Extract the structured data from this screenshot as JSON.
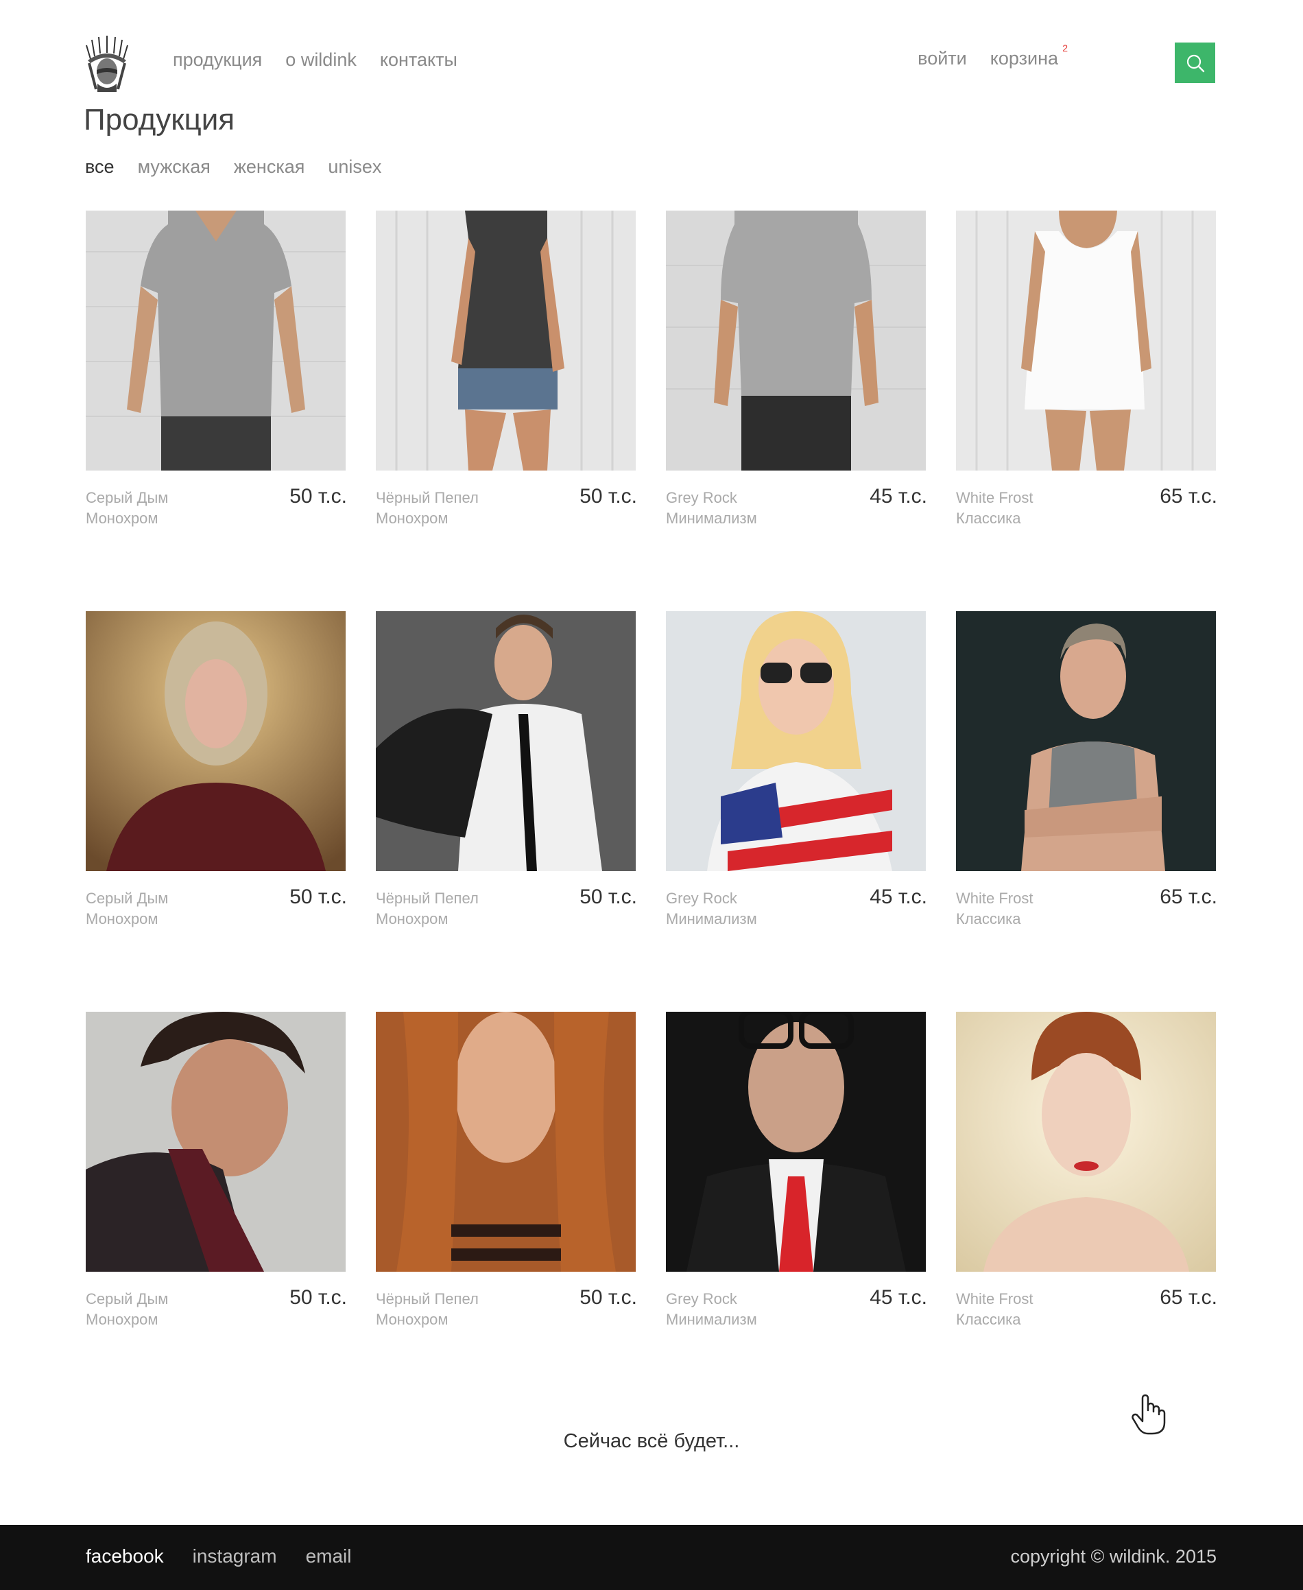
{
  "header": {
    "nav": [
      "продукция",
      "о wildink",
      "контакты"
    ],
    "login_label": "войти",
    "cart_label": "корзина",
    "cart_count": "2",
    "search_icon": "search-icon",
    "accent_color": "#3db66a"
  },
  "page": {
    "title": "Продукция",
    "filters": [
      "все",
      "мужская",
      "женская",
      "unisex"
    ],
    "active_filter": "все"
  },
  "products": [
    {
      "name1": "Серый Дым",
      "name2": "Монохром",
      "price": "50 т.с."
    },
    {
      "name1": "Чёрный Пепел",
      "name2": "Монохром",
      "price": "50 т.с."
    },
    {
      "name1": "Grey Rock",
      "name2": "Минимализм",
      "price": "45 т.с."
    },
    {
      "name1": "White Frost",
      "name2": "Классика",
      "price": "65 т.с."
    },
    {
      "name1": "Серый Дым",
      "name2": "Монохром",
      "price": "50 т.с."
    },
    {
      "name1": "Чёрный Пепел",
      "name2": "Монохром",
      "price": "50 т.с."
    },
    {
      "name1": "Grey Rock",
      "name2": "Минимализм",
      "price": "45 т.с."
    },
    {
      "name1": "White Frost",
      "name2": "Классика",
      "price": "65 т.с."
    },
    {
      "name1": "Серый Дым",
      "name2": "Монохром",
      "price": "50 т.с."
    },
    {
      "name1": "Чёрный Пепел",
      "name2": "Монохром",
      "price": "50 т.с."
    },
    {
      "name1": "Grey Rock",
      "name2": "Минимализм",
      "price": "45 т.с."
    },
    {
      "name1": "White Frost",
      "name2": "Классика",
      "price": "65 т.с."
    }
  ],
  "loading_text": "Сейчас всё будет...",
  "footer": {
    "links": [
      "facebook",
      "instagram",
      "email"
    ],
    "copyright": "copyright © wildink. 2015"
  }
}
